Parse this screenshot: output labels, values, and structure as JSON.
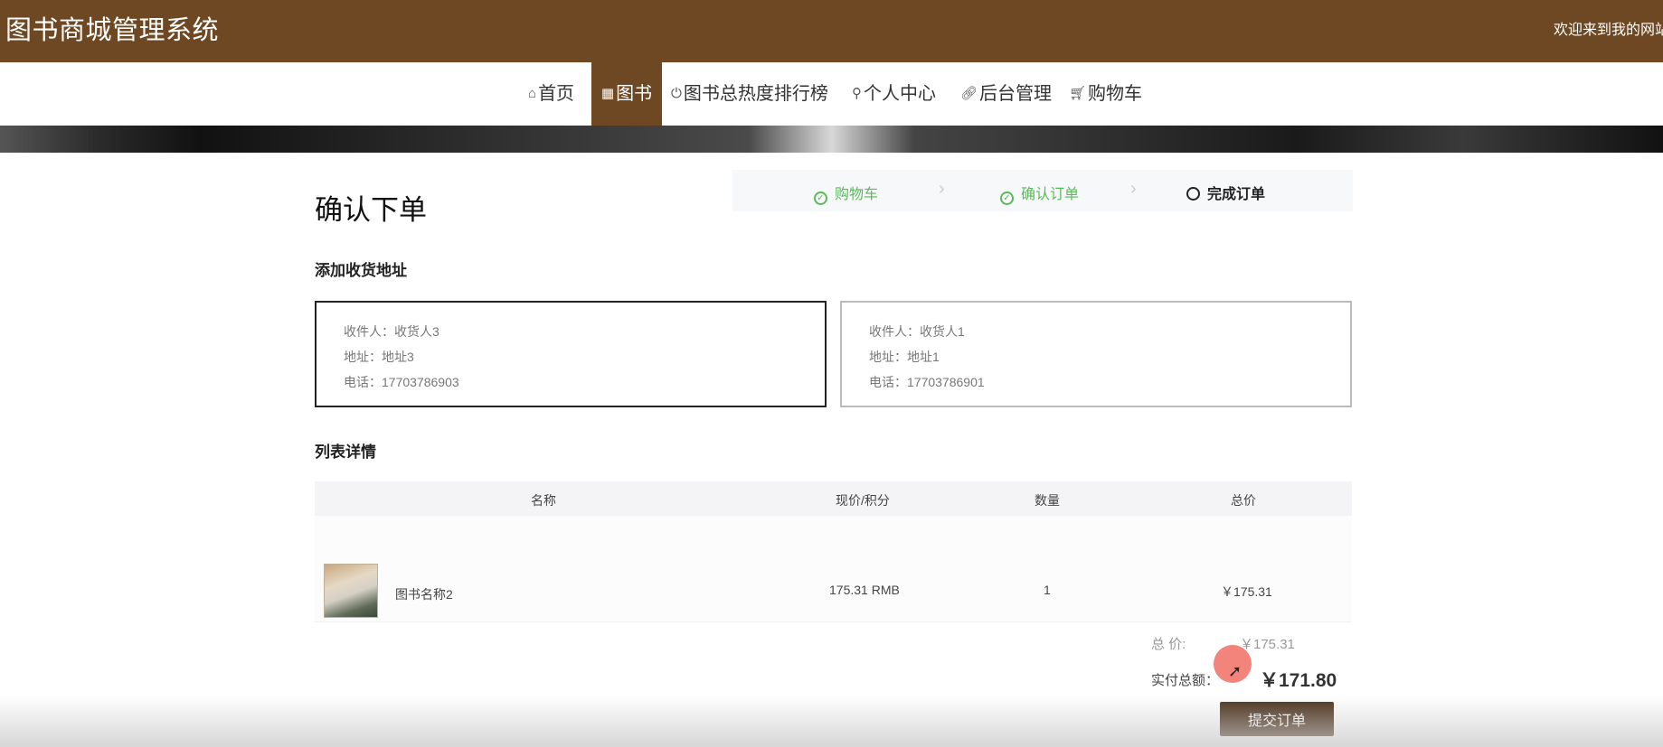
{
  "header": {
    "brand": "图书商城管理系统",
    "welcome": "欢迎来到我的网站"
  },
  "nav": {
    "items": [
      {
        "label": "首页",
        "icon": "home-icon"
      },
      {
        "label": "图书",
        "icon": "grid-icon",
        "active": true
      },
      {
        "label": "图书总热度排行榜",
        "icon": "power-icon"
      },
      {
        "label": "个人中心",
        "icon": "user-icon"
      },
      {
        "label": "后台管理",
        "icon": "link-icon"
      },
      {
        "label": "购物车",
        "icon": "cart-icon"
      }
    ]
  },
  "page": {
    "title": "确认下单"
  },
  "steps": [
    {
      "label": "购物车",
      "status": "done"
    },
    {
      "label": "确认订单",
      "status": "done"
    },
    {
      "label": "完成订单",
      "status": "current"
    }
  ],
  "address_section": {
    "title": "添加收货地址",
    "cards": [
      {
        "recipient": "收件人：收货人3",
        "address": "地址：地址3",
        "phone": "电话：17703786903",
        "selected": true
      },
      {
        "recipient": "收件人：收货人1",
        "address": "地址：地址1",
        "phone": "电话：17703786901",
        "selected": false
      }
    ]
  },
  "detail_section": {
    "title": "列表详情",
    "columns": [
      "名称",
      "现价/积分",
      "数量",
      "总价"
    ],
    "rows": [
      {
        "name": "图书名称2",
        "price": "175.31 RMB",
        "qty": "1",
        "total": "￥175.31"
      }
    ]
  },
  "summary": {
    "total_label": "总   价:",
    "total_value": "￥175.31",
    "pay_label": "实付总额：",
    "pay_value": "￥171.80"
  },
  "actions": {
    "submit_label": "提交订单"
  },
  "colors": {
    "brand": "#6e4822",
    "done": "#5cb85c",
    "submit": "#4a301b"
  }
}
